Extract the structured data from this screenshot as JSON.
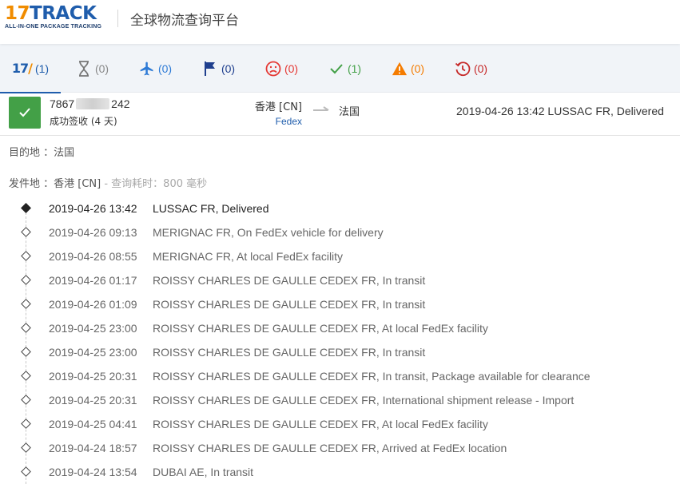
{
  "header": {
    "logo_num": "17",
    "logo_word": "TRACK",
    "logo_tagline": "ALL-IN-ONE PACKAGE TRACKING",
    "title": "全球物流查询平台"
  },
  "tabs": [
    {
      "icon": "17track-logo-icon",
      "count": "(1)",
      "color": "#1f5dac",
      "logo": "17",
      "active": true
    },
    {
      "icon": "hourglass-icon",
      "count": "(0)",
      "color": "#888888"
    },
    {
      "icon": "airplane-icon",
      "count": "(0)",
      "color": "#2d7ad6"
    },
    {
      "icon": "flag-icon",
      "count": "(0)",
      "color": "#1f3f8e"
    },
    {
      "icon": "sad-face-icon",
      "count": "(0)",
      "color": "#e53935"
    },
    {
      "icon": "checkmark-icon",
      "count": "(1)",
      "color": "#43a047"
    },
    {
      "icon": "warning-icon",
      "count": "(0)",
      "color": "#f57c00"
    },
    {
      "icon": "history-icon",
      "count": "(0)",
      "color": "#c62828"
    }
  ],
  "summary": {
    "tracking_prefix": "7867",
    "tracking_suffix": "242",
    "status": "成功签收 (4 天)",
    "origin": "香港 [CN]",
    "carrier": "Fedex",
    "destination": "法国",
    "latest_event": "2019-04-26 13:42  LUSSAC FR, Delivered"
  },
  "info": {
    "destination_label": "目的地 ：",
    "destination_value": "法国",
    "origin_label": "发件地 ：",
    "origin_value": "香港 [CN]",
    "query_time": " - 查询耗时：800 毫秒"
  },
  "events": [
    {
      "time": "2019-04-26 13:42",
      "desc": "LUSSAC FR, Delivered"
    },
    {
      "time": "2019-04-26 09:13",
      "desc": "MERIGNAC FR, On FedEx vehicle for delivery"
    },
    {
      "time": "2019-04-26 08:55",
      "desc": "MERIGNAC FR, At local FedEx facility"
    },
    {
      "time": "2019-04-26 01:17",
      "desc": "ROISSY CHARLES DE GAULLE CEDEX FR, In transit"
    },
    {
      "time": "2019-04-26 01:09",
      "desc": "ROISSY CHARLES DE GAULLE CEDEX FR, In transit"
    },
    {
      "time": "2019-04-25 23:00",
      "desc": "ROISSY CHARLES DE GAULLE CEDEX FR, At local FedEx facility"
    },
    {
      "time": "2019-04-25 23:00",
      "desc": "ROISSY CHARLES DE GAULLE CEDEX FR, In transit"
    },
    {
      "time": "2019-04-25 20:31",
      "desc": "ROISSY CHARLES DE GAULLE CEDEX FR, In transit, Package available for clearance"
    },
    {
      "time": "2019-04-25 20:31",
      "desc": "ROISSY CHARLES DE GAULLE CEDEX FR, International shipment release - Import"
    },
    {
      "time": "2019-04-25 04:41",
      "desc": "ROISSY CHARLES DE GAULLE CEDEX FR, At local FedEx facility"
    },
    {
      "time": "2019-04-24 18:57",
      "desc": "ROISSY CHARLES DE GAULLE CEDEX FR, Arrived at FedEx location"
    },
    {
      "time": "2019-04-24 13:54",
      "desc": "DUBAI AE, In transit"
    }
  ]
}
